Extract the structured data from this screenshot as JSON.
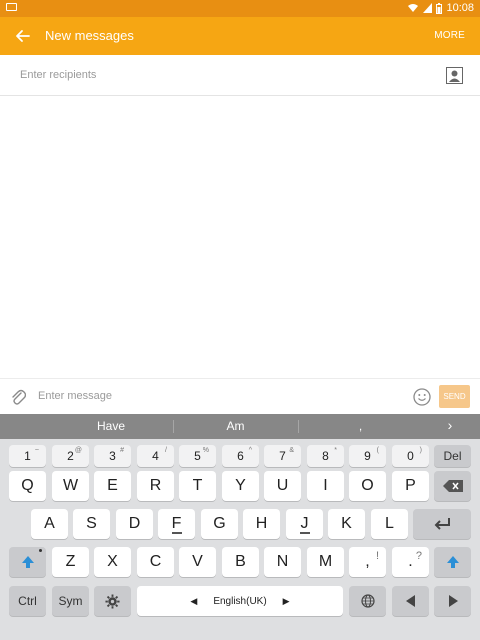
{
  "status_bar": {
    "time": "10:08",
    "icons": [
      "message-icon",
      "wifi-icon",
      "signal-icon",
      "battery-icon"
    ]
  },
  "app_bar": {
    "title": "New messages",
    "more_label": "MORE",
    "color": "#f6a613"
  },
  "recipients": {
    "placeholder": "Enter recipients"
  },
  "composer": {
    "placeholder": "Enter message",
    "send_label": "SEND"
  },
  "keyboard": {
    "suggestions": [
      "Have",
      "Am",
      ","
    ],
    "number_row": [
      {
        "label": "1",
        "sub": "~"
      },
      {
        "label": "2",
        "sub": "@"
      },
      {
        "label": "3",
        "sub": "#"
      },
      {
        "label": "4",
        "sub": "/"
      },
      {
        "label": "5",
        "sub": "%"
      },
      {
        "label": "6",
        "sub": "^"
      },
      {
        "label": "7",
        "sub": "&"
      },
      {
        "label": "8",
        "sub": "*"
      },
      {
        "label": "9",
        "sub": "("
      },
      {
        "label": "0",
        "sub": ")"
      }
    ],
    "del_label": "Del",
    "row1": [
      "Q",
      "W",
      "E",
      "R",
      "T",
      "Y",
      "U",
      "I",
      "O",
      "P"
    ],
    "row2": [
      "A",
      "S",
      "D",
      "F",
      "G",
      "H",
      "J",
      "K",
      "L"
    ],
    "row3": [
      "Z",
      "X",
      "C",
      "V",
      "B",
      "N",
      "M"
    ],
    "comma_key": ",",
    "comma_sub": "!",
    "period_key": ".",
    "period_sub": "?",
    "ctrl_label": "Ctrl",
    "sym_label": "Sym",
    "language_label": "English(UK)"
  }
}
